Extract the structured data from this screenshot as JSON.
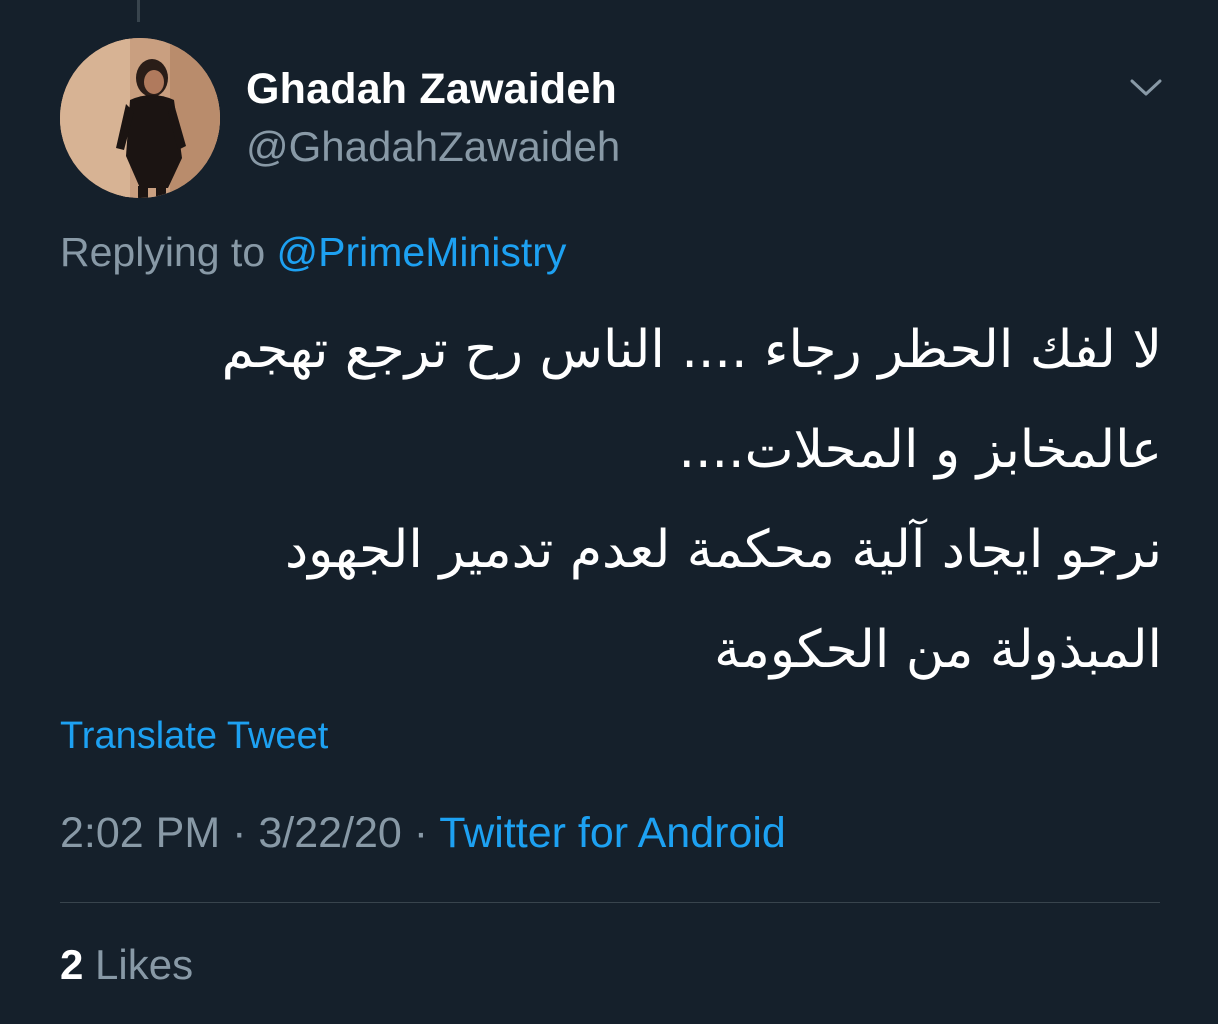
{
  "tweet": {
    "author": {
      "display_name": "Ghadah Zawaideh",
      "handle": "@GhadahZawaideh",
      "avatar_icon": "profile-photo"
    },
    "menu_icon": "chevron-down-icon",
    "replying_prefix": "Replying to",
    "replying_to": "@PrimeMinistry",
    "text_lines": [
      "لا لفك الحظر رجاء .... الناس رح ترجع تهجم",
      "عالمخابز و المحلات....",
      "نرجو ايجاد آلية محكمة لعدم تدمير الجهود",
      "المبذولة من الحكومة"
    ],
    "translate_label": "Translate Tweet",
    "time": "2:02 PM",
    "date": "3/22/20",
    "separator": "·",
    "source": "Twitter for Android",
    "likes_count": "2",
    "likes_label": "Likes"
  },
  "colors": {
    "background": "#15202b",
    "primary_text": "#ffffff",
    "secondary_text": "#8899a6",
    "accent": "#1da1f2",
    "divider": "#38444d"
  }
}
